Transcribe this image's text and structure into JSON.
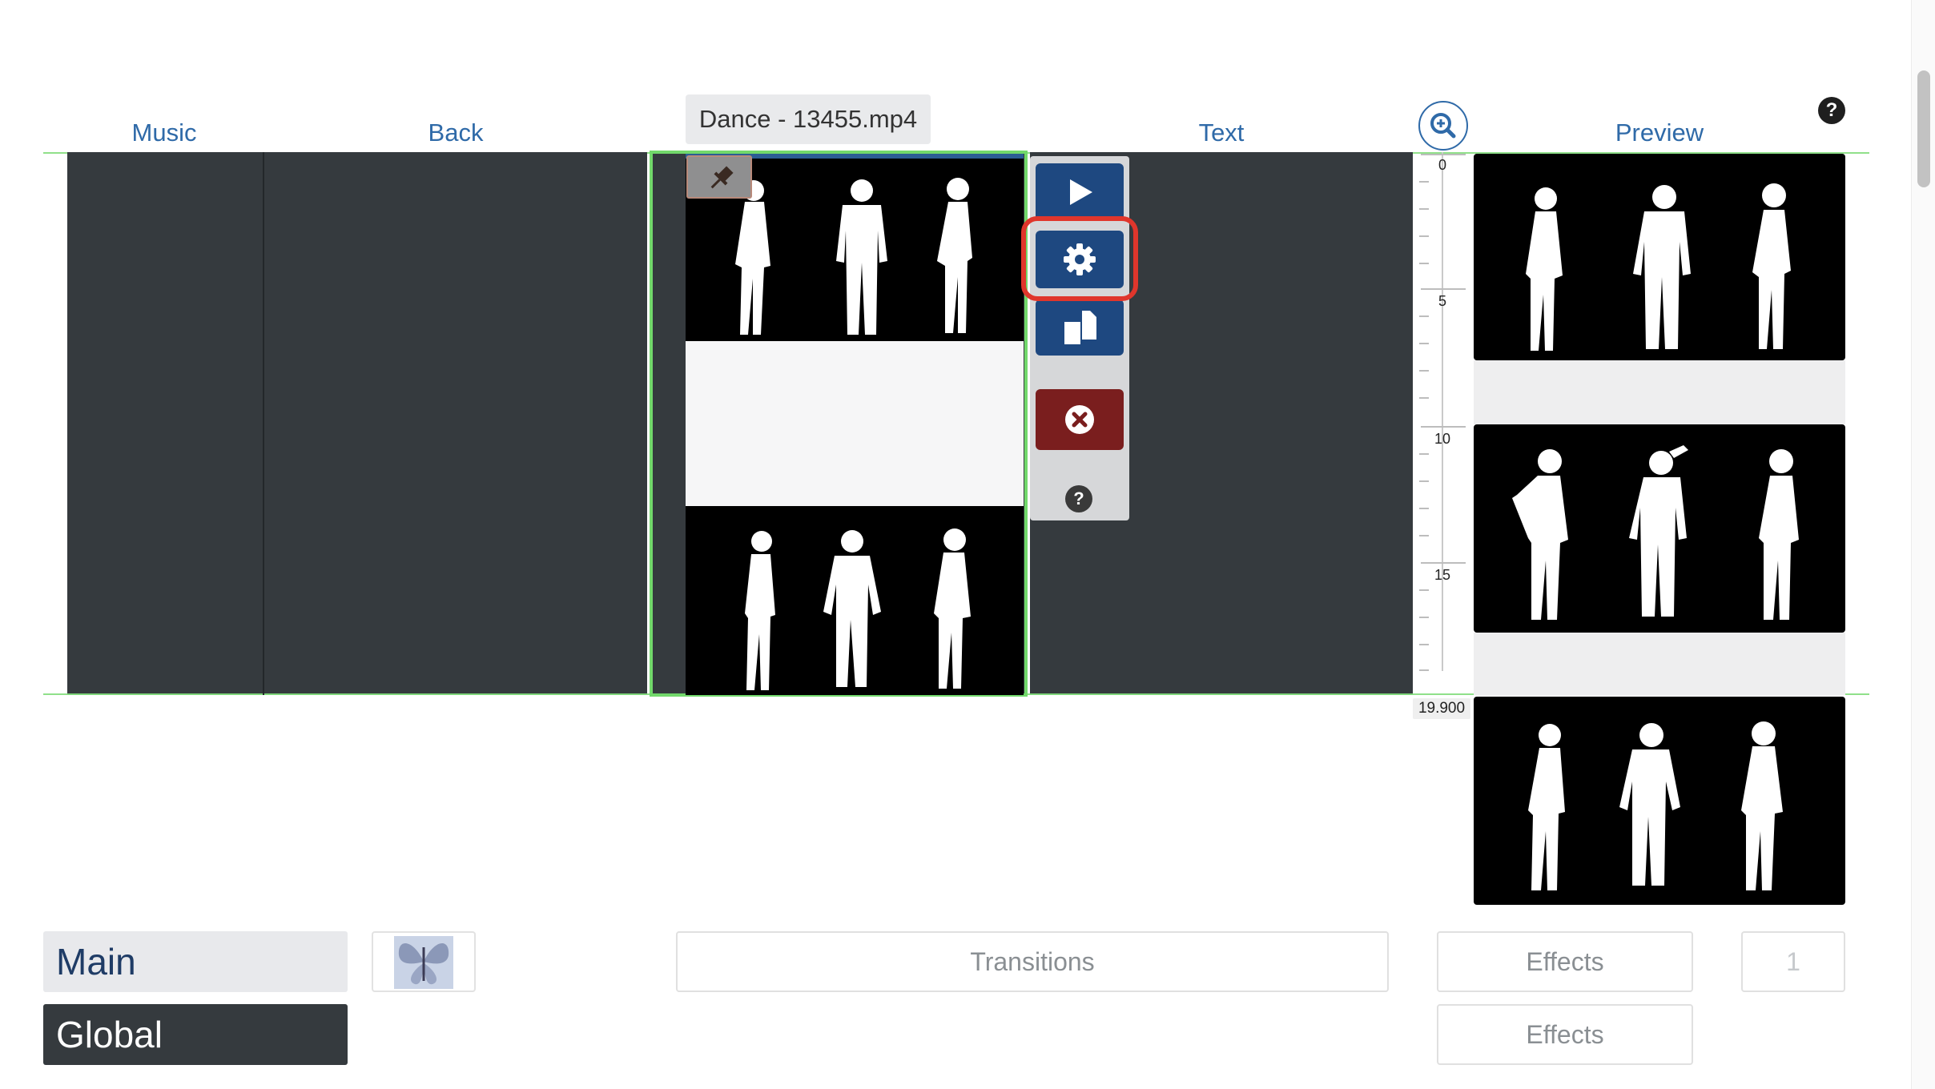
{
  "lanes": {
    "music_label": "Music",
    "back_label": "Back",
    "text_label": "Text",
    "preview_label": "Preview"
  },
  "clip": {
    "file_name": "Dance - 13455.mp4"
  },
  "toolbar": {
    "play": "play",
    "settings": "settings",
    "duplicate": "duplicate",
    "delete": "delete",
    "help": "?"
  },
  "help_top": "?",
  "ruler": {
    "ticks": [
      "0",
      "5",
      "10",
      "15"
    ],
    "end_value": "19.900"
  },
  "bottom": {
    "main_tab": "Main",
    "global_tab": "Global",
    "transitions_label": "Transitions",
    "effects_label_1": "Effects",
    "effects_label_2": "Effects",
    "count_value": "1"
  },
  "colors": {
    "accent_blue": "#1e4880",
    "link_blue": "#2f6aa8",
    "danger_red": "#7a1e1e",
    "highlight_red": "#e0362c",
    "selection_green": "#72d86b",
    "lane_dark": "#353a3e"
  },
  "icons": [
    "pin-icon",
    "play-icon",
    "gear-icon",
    "copy-icon",
    "close-icon",
    "zoom-in-icon",
    "help-icon",
    "butterfly-icon"
  ]
}
